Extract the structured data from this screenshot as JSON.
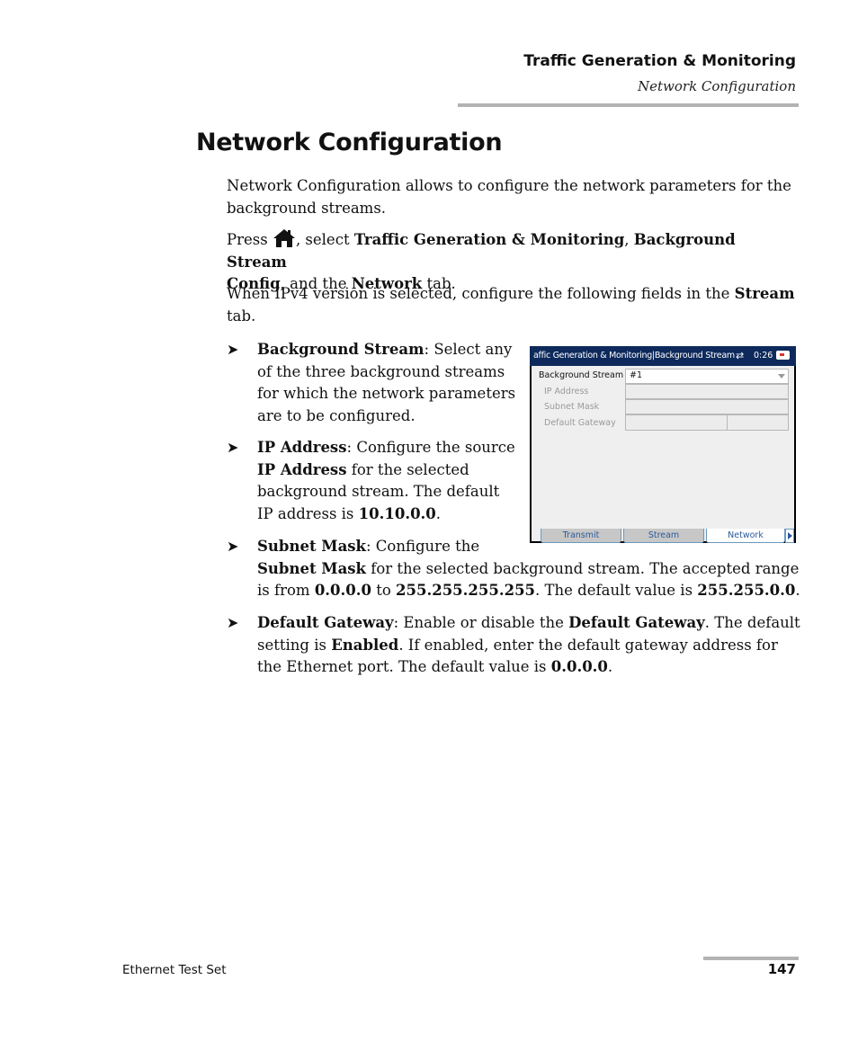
{
  "header": {
    "chapter": "Traffic Generation & Monitoring",
    "section": "Network Configuration"
  },
  "page_title": "Network Configuration",
  "intro": "Network Configuration allows to configure the network parameters for the background streams.",
  "press": {
    "p1": "Press ",
    "icon": "home-icon",
    "p2": ", select ",
    "b1": "Traffic Generation & Monitoring",
    "p3": ", ",
    "b2": "Background Stream",
    "b3": "Config",
    "p4": ", and the ",
    "b4": "Network",
    "p5": " tab."
  },
  "ipv4": {
    "p1": "When IPv4 version is selected, configure the following fields in the ",
    "b1": "Stream",
    "p2": "tab."
  },
  "bullets": {
    "arrow": "➤",
    "bg_stream": {
      "b": "Background Stream",
      "l1": ": Select any",
      "l2": "of the three background streams",
      "l3": "for which the network parameters",
      "l4": "are to be configured."
    },
    "ip": {
      "b": "IP Address",
      "l1": ": Configure the source",
      "b2": "IP Address",
      "l2": " for the selected",
      "l3": "background stream. The default",
      "l4a": "IP address is ",
      "b3": "10.10.0.0",
      "l4b": "."
    },
    "subnet": {
      "b": "Subnet Mask",
      "l1": ": Configure the",
      "b2": "Subnet Mask",
      "l2": " for the selected background stream. The accepted range",
      "l3a": "is from ",
      "b3": "0.0.0.0",
      "l3b": " to ",
      "b4": "255.255.255.255",
      "l3c": ". The default value is ",
      "b5": "255.255.0.0",
      "l3d": "."
    },
    "gateway": {
      "b": "Default Gateway",
      "l1": ": Enable or disable the ",
      "b2": "Default Gateway",
      "l1b": ". The default",
      "l2a": "setting is ",
      "b3": "Enabled",
      "l2b": ". If enabled, enter the default gateway address for",
      "l3a": "the Ethernet port. The default value is ",
      "b4": "0.0.0.0",
      "l3b": "."
    }
  },
  "device": {
    "title": "affic Generation  & Monitoring|Background Stream",
    "time": "0:26",
    "sync_icon": "⇄",
    "fields": {
      "bg_stream_label": "Background Stream",
      "bg_stream_value": "#1",
      "ip_label": "IP Address",
      "subnet_label": "Subnet Mask",
      "gateway_label": "Default Gateway"
    },
    "tabs": [
      "Transmit",
      "Stream",
      "Network"
    ],
    "active_tab": "Network",
    "colors": {
      "titlebar": "#0e2a5c",
      "tab_text": "#2a5b9a"
    }
  },
  "footer": {
    "doc_name": "Ethernet Test Set",
    "page_number": "147"
  }
}
